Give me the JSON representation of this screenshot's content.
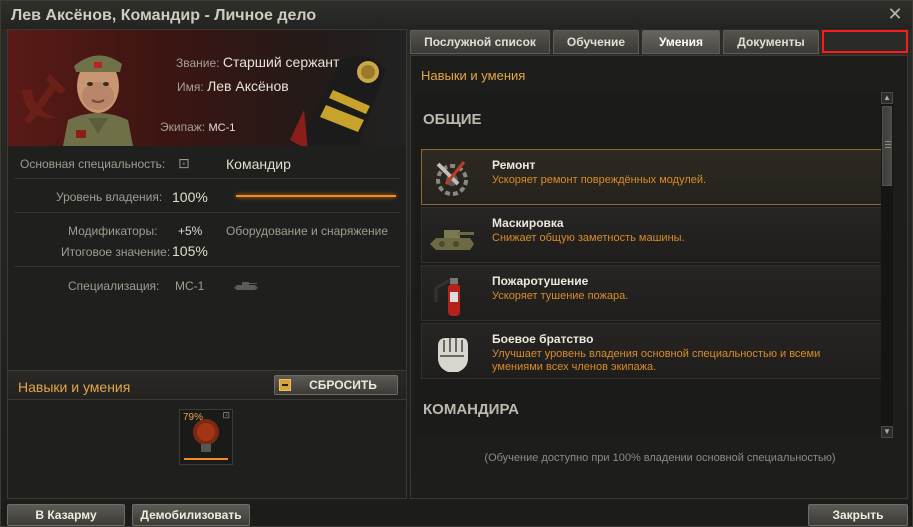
{
  "window": {
    "title": "Лев Аксёнов, Командир - Личное дело",
    "close": "✕"
  },
  "tankman": {
    "rank_label": "Звание:",
    "rank_value": "Старший сержант",
    "name_label": "Имя:",
    "name_value": "Лев Аксёнов",
    "crew_label": "Экипаж:",
    "crew_value": "МС-1"
  },
  "stats": {
    "main_specialty_label": "Основная специальность:",
    "main_specialty_value": "Командир",
    "mastery_label": "Уровень владения:",
    "mastery_value": "100%",
    "mastery_fraction": 1.0,
    "modifiers_label": "Модификаторы:",
    "modifiers_value": "+5%",
    "modifiers_source": "Оборудование и снаряжение",
    "final_label": "Итоговое значение:",
    "final_value": "105%",
    "specialization_label": "Специализация:",
    "specialization_value": "МС-1"
  },
  "left_skills": {
    "title": "Навыки и умения",
    "reset_button": "СБРОСИТЬ",
    "new_skill_progress": "79%"
  },
  "tabs": [
    {
      "label": "Послужной список",
      "active": false
    },
    {
      "label": "Обучение",
      "active": false
    },
    {
      "label": "Умения",
      "active": true
    },
    {
      "label": "Документы",
      "active": false
    }
  ],
  "right_panel": {
    "header": "Навыки и умения",
    "sections": [
      {
        "title": "ОБЩИЕ"
      },
      {
        "title": "КОМАНДИРА"
      }
    ],
    "skills": [
      {
        "name": "Ремонт",
        "description": "Ускоряет ремонт повреждённых модулей.",
        "icon": "repair-wrench-icon",
        "selected": true
      },
      {
        "name": "Маскировка",
        "description": "Снижает общую заметность машины.",
        "icon": "camouflage-tank-icon",
        "selected": false
      },
      {
        "name": "Пожаротушение",
        "description": "Ускоряет тушение пожара.",
        "icon": "fire-extinguisher-icon",
        "selected": false
      },
      {
        "name": "Боевое братство",
        "description": "Улучшает уровень владения основной специальностью и всеми умениями всех членов экипажа.",
        "icon": "brotherhood-fist-icon",
        "selected": false
      }
    ],
    "footnote": "(Обучение доступно при 100% владении основной специальностью)"
  },
  "buttons": {
    "barracks": "В Казарму",
    "demobilize": "Демобилизовать",
    "close": "Закрыть"
  },
  "colors": {
    "accent_orange": "#e3a64a",
    "highlight_box": "#ff1a1a",
    "progress": "#f08a24"
  }
}
